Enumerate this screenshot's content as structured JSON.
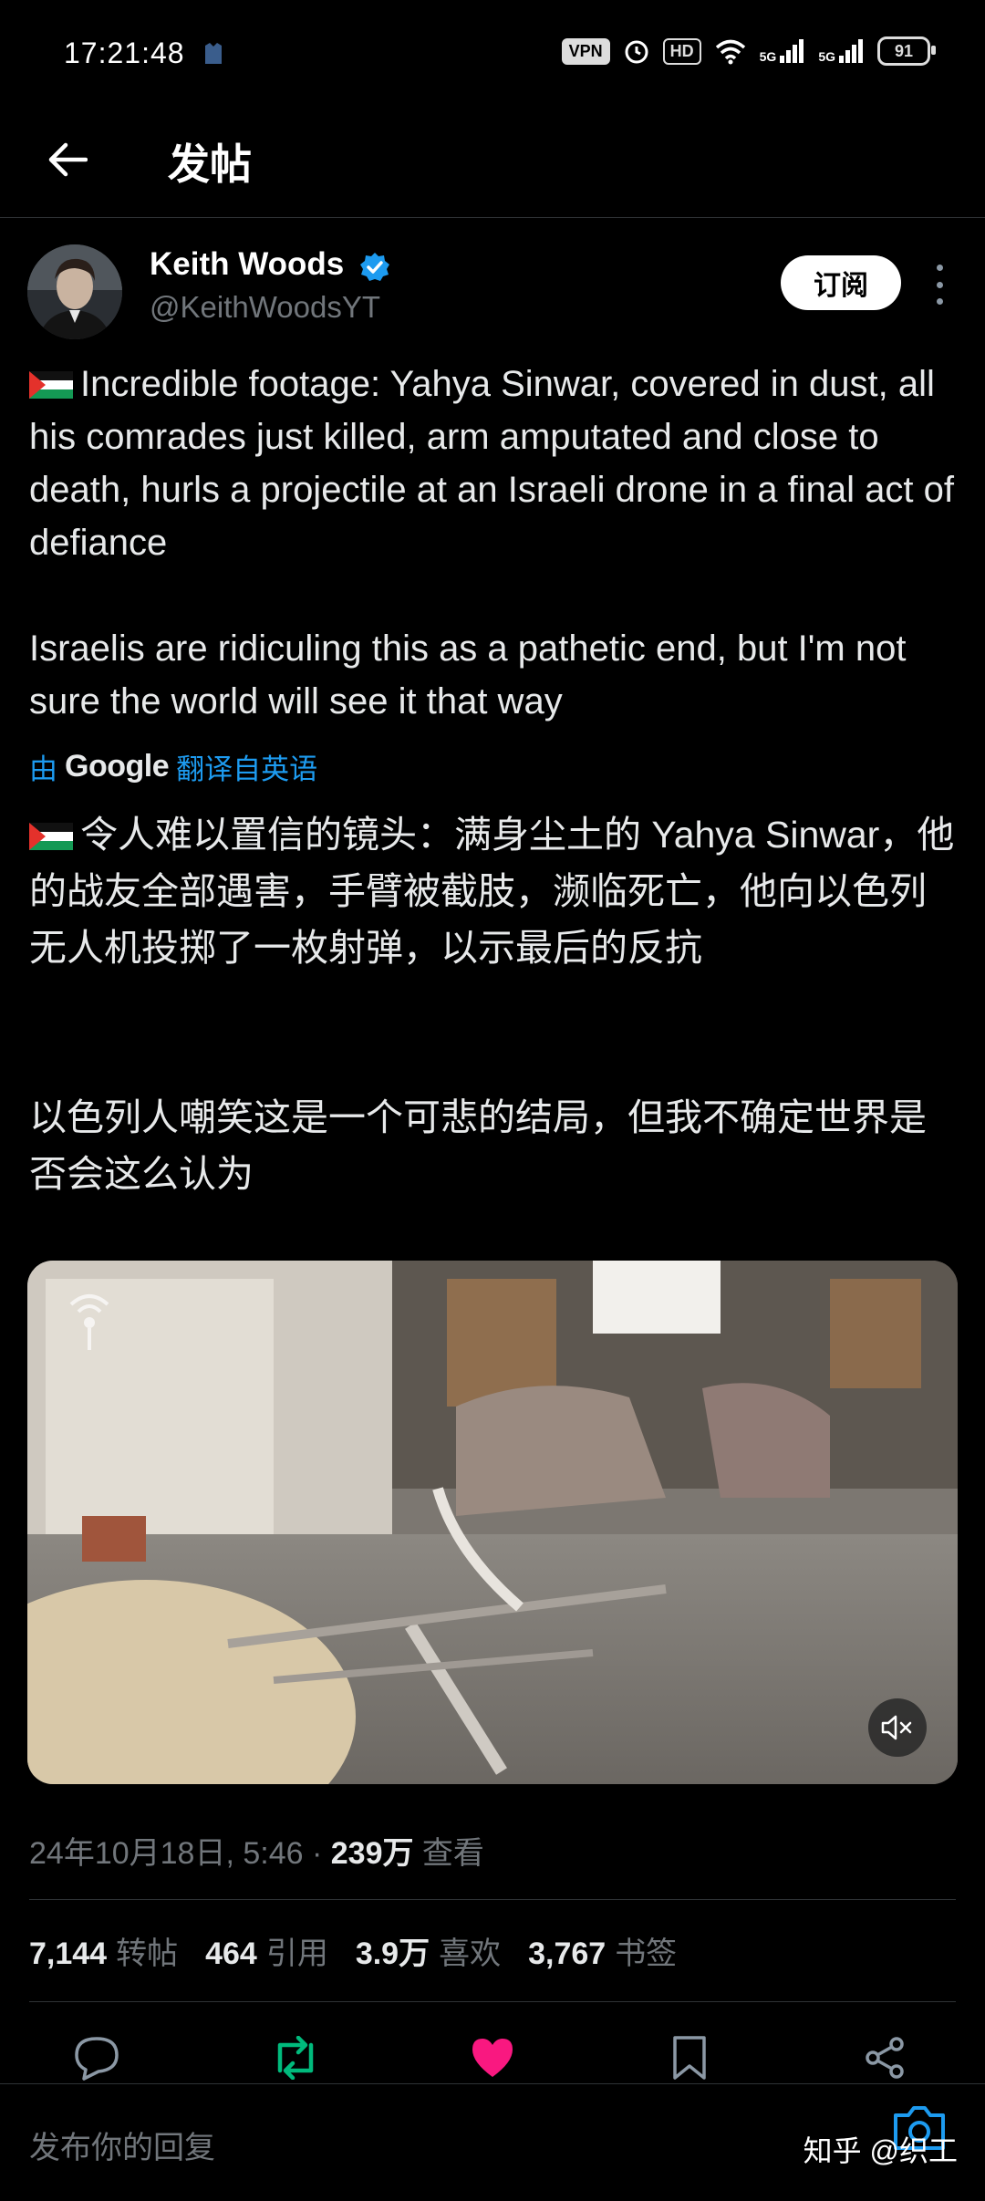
{
  "status_bar": {
    "time": "17:21:48",
    "vpn": "VPN",
    "hd": "HD",
    "signal_1": "5G",
    "signal_2": "5G",
    "battery": "91"
  },
  "header": {
    "title": "发帖"
  },
  "author": {
    "name": "Keith Woods",
    "handle": "@KeithWoodsYT",
    "subscribe_label": "订阅"
  },
  "tweet": {
    "original_p1": "Incredible footage: Yahya Sinwar, covered in dust, all his comrades just killed, arm amputated and close to death, hurls a projectile at an Israeli drone in a final act of defiance",
    "original_p2": "Israelis are ridiculing this as a pathetic end, but I'm not sure the world will see it that way",
    "translate_prefix": "由",
    "translate_brand": "Google",
    "translate_suffix": "翻译自英语",
    "translated_p1": "令人难以置信的镜头：满身尘土的 Yahya Sinwar，他的战友全部遇害，手臂被截肢，濒临死亡，他向以色列无人机投掷了一枚射弹，以示最后的反抗",
    "translated_p2": "以色列人嘲笑这是一个可悲的结局，但我不确定世界是否会这么认为"
  },
  "meta": {
    "date": "24年10月18日, 5:46 · ",
    "views_count": "239万",
    "views_label": " 查看"
  },
  "stats": [
    {
      "count": "7,144",
      "label": "转帖"
    },
    {
      "count": "464",
      "label": "引用"
    },
    {
      "count": "3.9万",
      "label": "喜欢"
    },
    {
      "count": "3,767",
      "label": "书签"
    }
  ],
  "colors": {
    "accent": "#1d9bf0",
    "retweet": "#00ba7c",
    "like": "#f91880",
    "muted": "#71767b"
  },
  "reply": {
    "placeholder": "发布你的回复"
  },
  "watermark": "知乎 @织工"
}
